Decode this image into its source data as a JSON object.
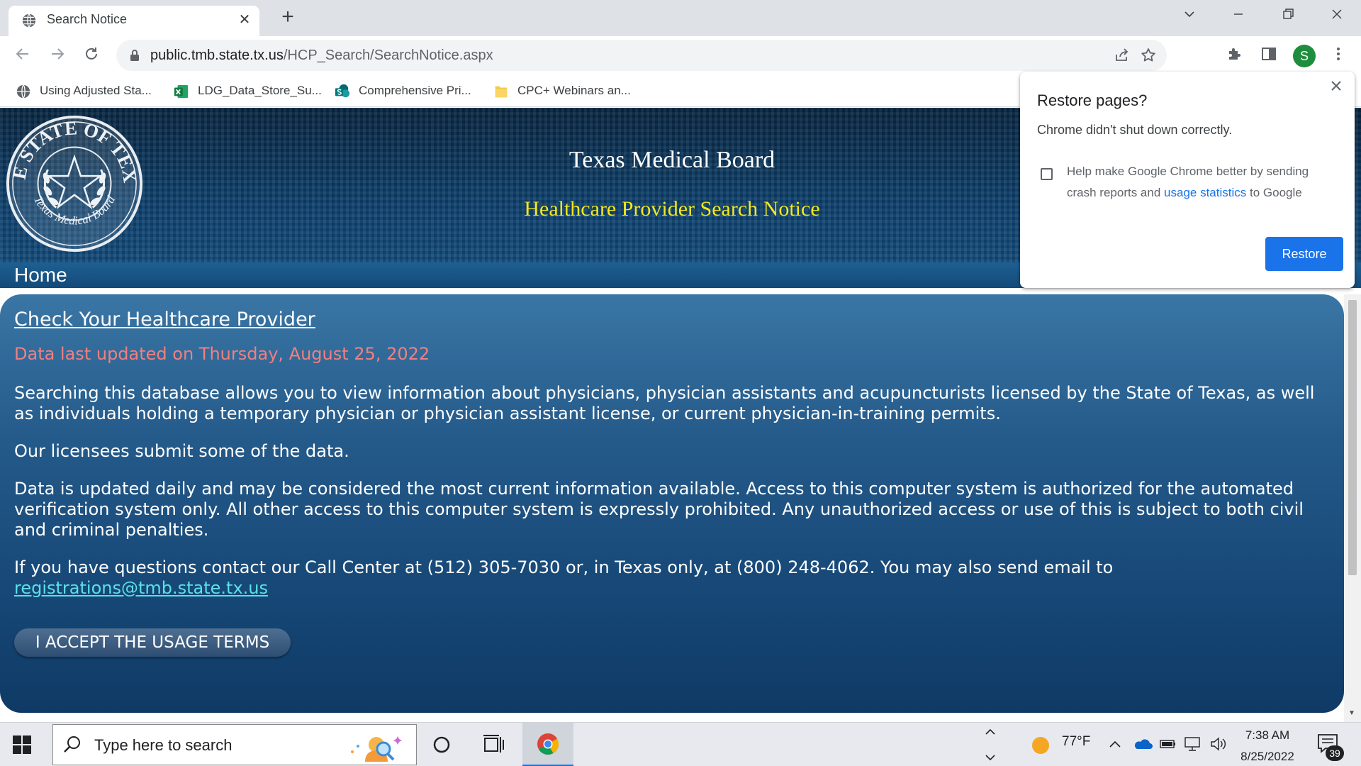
{
  "browser": {
    "tab_title": "Search Notice",
    "tab_close": "✕",
    "new_tab": "+",
    "url_host": "public.tmb.state.tx.us",
    "url_path": "/HCP_Search/SearchNotice.aspx",
    "profile_initial": "S",
    "profile_color": "#1e8e3e"
  },
  "bookmarks": [
    {
      "label": "Using Adjusted Sta...",
      "icon": "globe-icon"
    },
    {
      "label": "LDG_Data_Store_Su...",
      "icon": "excel-icon"
    },
    {
      "label": "Comprehensive Pri...",
      "icon": "sharepoint-icon"
    },
    {
      "label": "CPC+ Webinars an...",
      "icon": "folder-icon"
    }
  ],
  "banner": {
    "seal_text_top": "THE STATE OF TEXAS",
    "seal_text_bottom": "Texas Medical Board",
    "title": "Texas Medical Board",
    "subtitle": "Healthcare Provider Search Notice",
    "subtitle_color": "#f4e81e"
  },
  "nav": {
    "home": "Home"
  },
  "content": {
    "heading": "Check Your Healthcare Provider",
    "updated": "Data last updated on Thursday, August 25, 2022",
    "updated_color": "#f08080",
    "p1": "Searching this database allows you to view information about physicians, physician assistants and acupuncturists licensed by the State of Texas, as well as individuals holding a temporary physician or physician assistant license, or current physician-in-training permits.",
    "p2": "Our licensees submit some of the data.",
    "p3": "Data is updated daily and may be considered the most current information available. Access to this computer system is authorized for the automated verification system only. All other access to this computer system is expressly prohibited. Any unauthorized access or use of this is subject to both civil and criminal penalties.",
    "p4": "If you have questions contact our Call Center at (512) 305-7030 or, in Texas only, at (800) 248-4062. You may also send email to",
    "email": "registrations@tmb.state.tx.us",
    "accept_button": "I ACCEPT THE USAGE TERMS"
  },
  "popup": {
    "title": "Restore pages?",
    "message": "Chrome didn't shut down correctly.",
    "checkbox_checked": false,
    "checkbox_text_before": "Help make Google Chrome better by sending crash reports and",
    "checkbox_link": "usage statistics",
    "checkbox_text_after": "to Google",
    "restore_button": "Restore",
    "accent_color": "#1a73e8"
  },
  "taskbar": {
    "search_placeholder": "Type here to search",
    "weather_temp": "77°F",
    "time": "7:38 AM",
    "date": "8/25/2022",
    "notification_count": "39"
  }
}
